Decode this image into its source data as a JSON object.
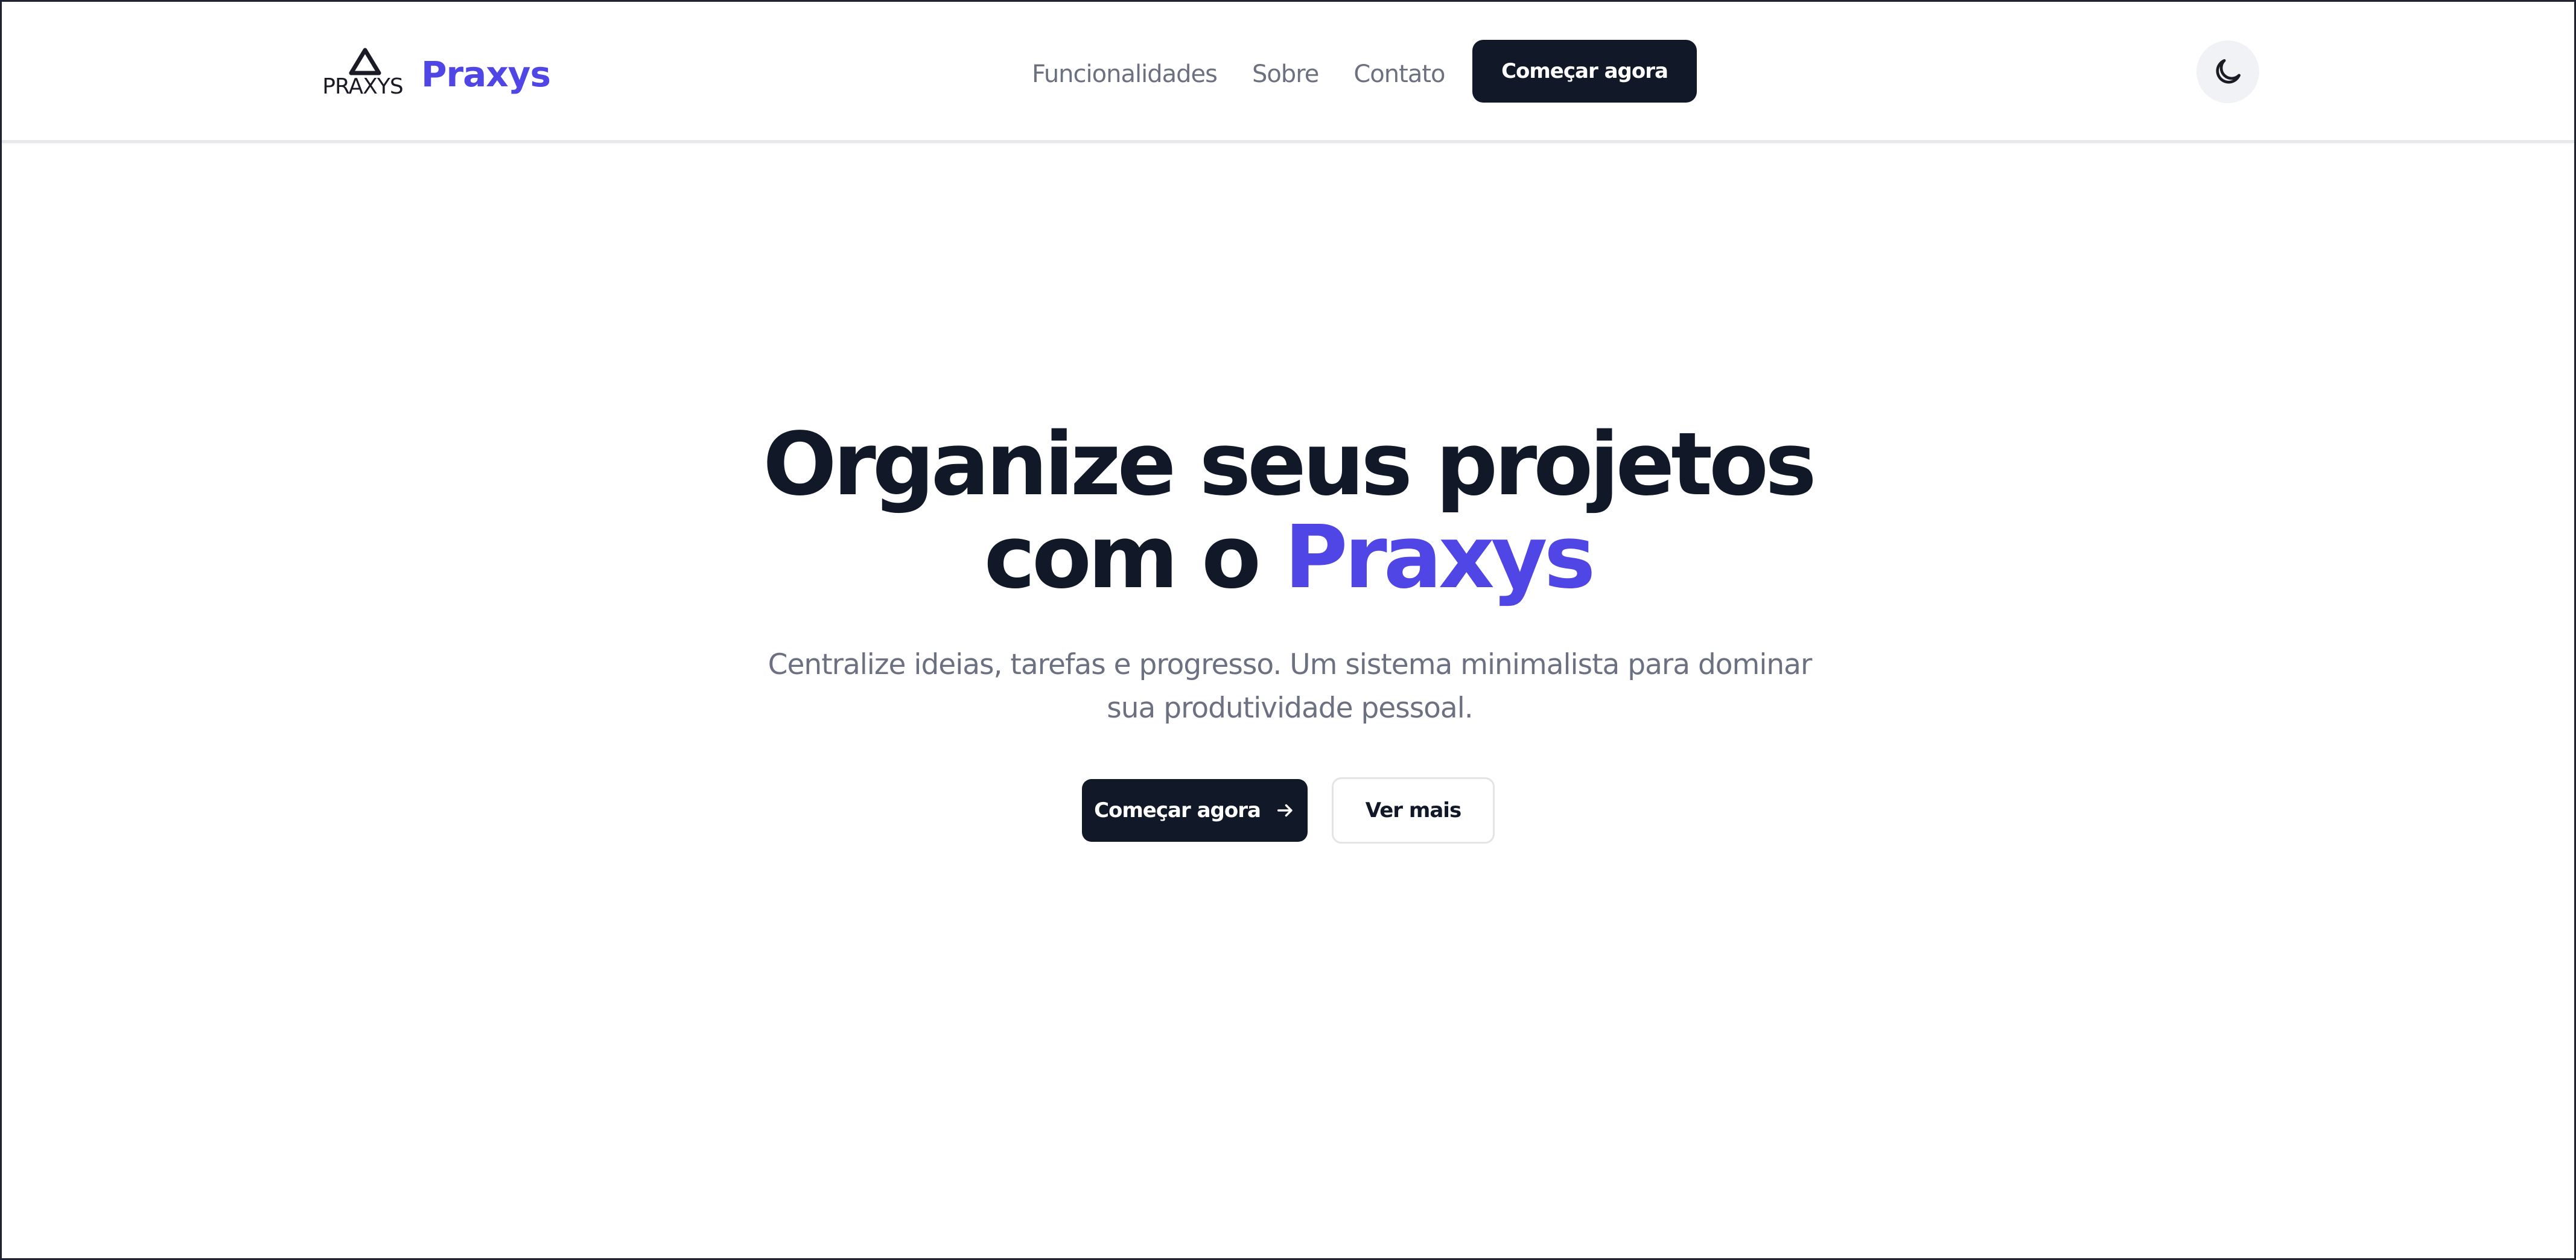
{
  "header": {
    "logo_text": "PRAXYS",
    "brand_name": "Praxys",
    "nav": [
      {
        "label": "Funcionalidades"
      },
      {
        "label": "Sobre"
      },
      {
        "label": "Contato"
      }
    ],
    "cta_label": "Começar agora",
    "theme_toggle_icon": "moon-icon"
  },
  "hero": {
    "title_line1": "Organize seus projetos",
    "title_line2_prefix": "com o ",
    "title_accent": "Praxys",
    "subtitle_line1": "Centralize ideias, tarefas e progresso. Um sistema minimalista para dominar",
    "subtitle_line2": "sua produtividade pessoal.",
    "primary_label": "Começar agora",
    "primary_icon": "arrow-right-icon",
    "secondary_label": "Ver mais"
  },
  "colors": {
    "accent": "#4f46e5",
    "dark": "#111827",
    "muted_text": "#6b7180",
    "toggle_bg": "#f1f2f5"
  }
}
